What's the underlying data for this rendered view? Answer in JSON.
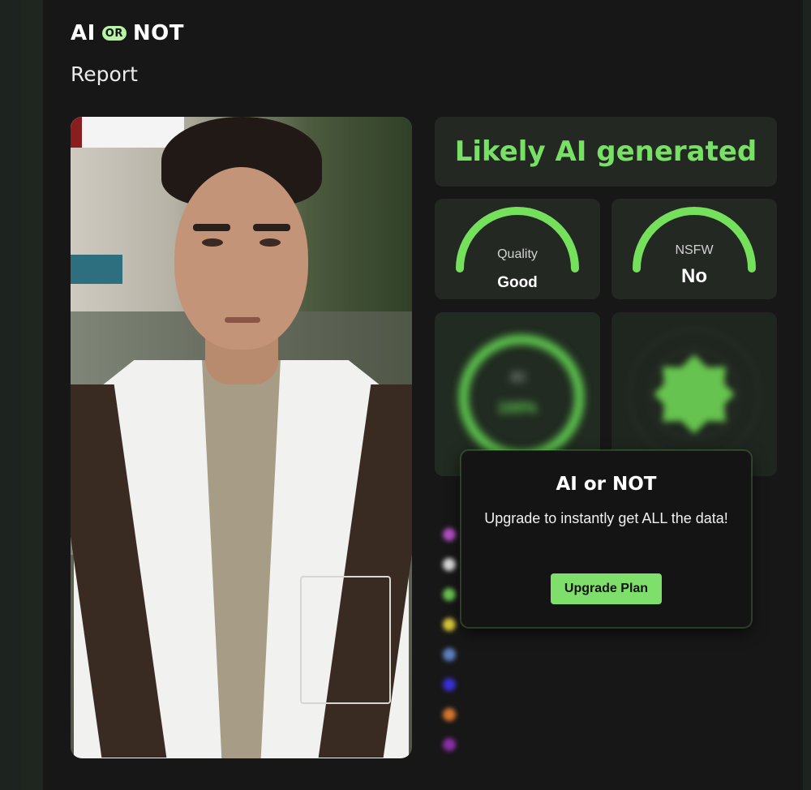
{
  "brand": {
    "left": "AI",
    "or": "OR",
    "right": "NOT"
  },
  "page_title": "Report",
  "verdict": {
    "text": "Likely AI generated",
    "color": "#78e064"
  },
  "gauges": [
    {
      "label": "Quality",
      "value": "Good"
    },
    {
      "label": "NSFW",
      "value": "No"
    }
  ],
  "ai_ring": {
    "label": "AI",
    "percent": "100%"
  },
  "modal": {
    "title": "AI or NOT",
    "text": "Upgrade to instantly get ALL the data!",
    "button": "Upgrade Plan"
  },
  "colors": {
    "accent": "#7ee06a",
    "background": "#171717",
    "card": "#232823"
  },
  "icons": [
    "brand-or-badge"
  ]
}
